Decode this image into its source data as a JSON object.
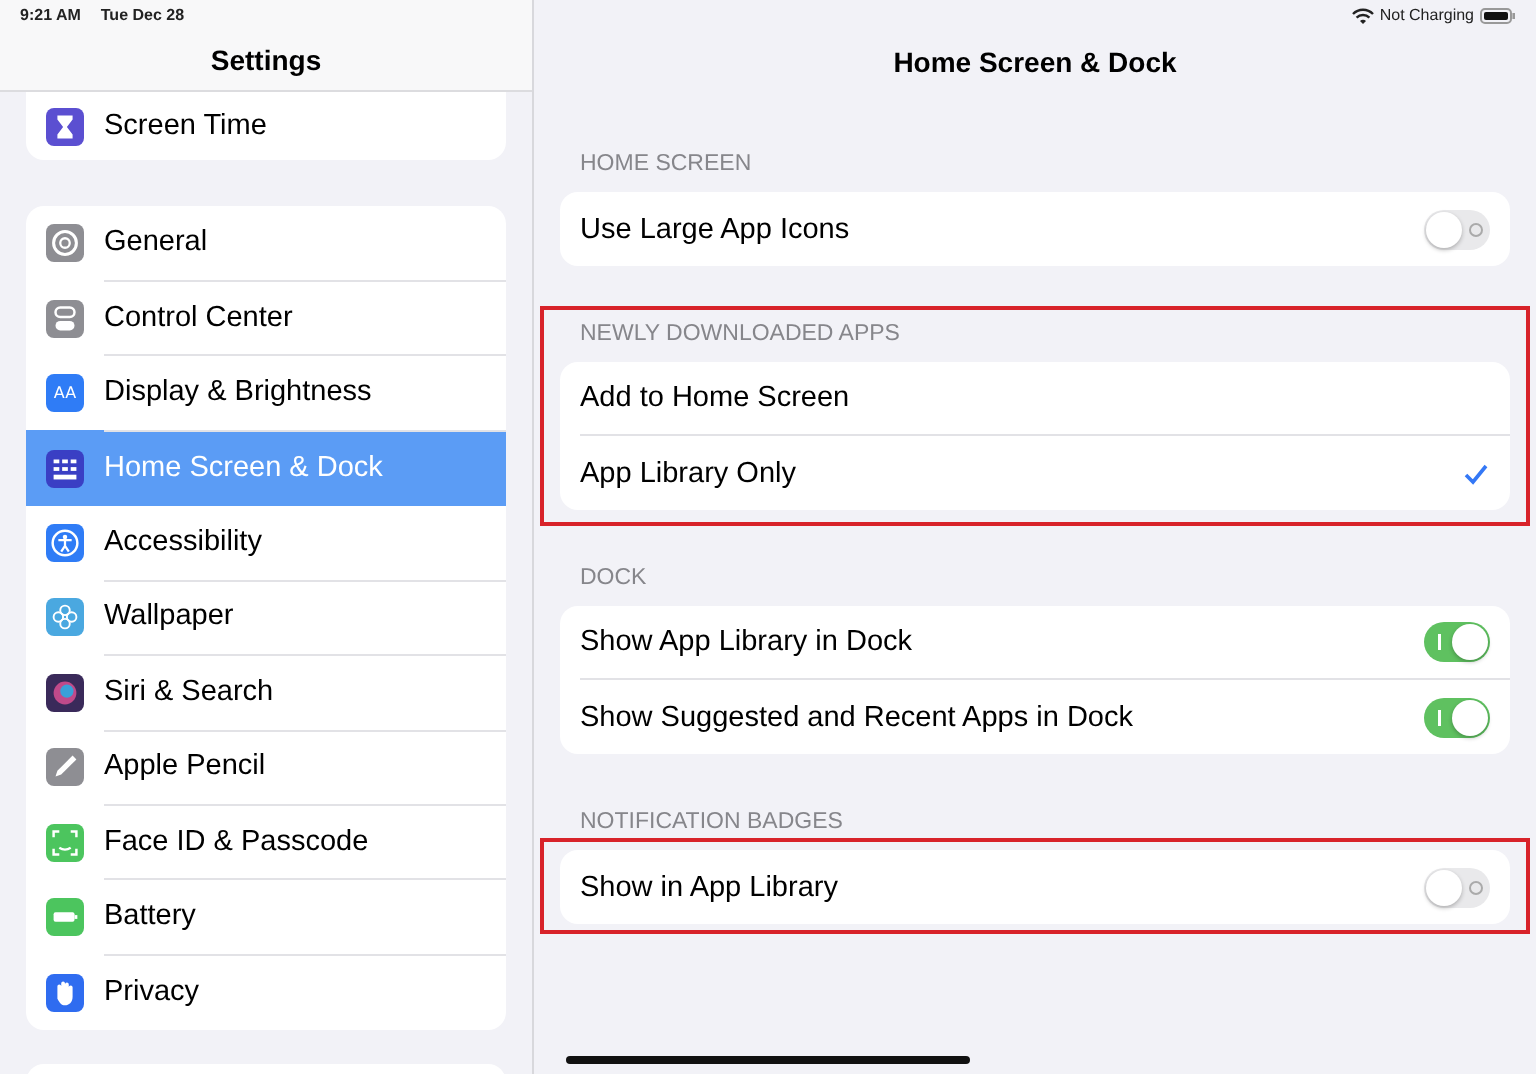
{
  "status_bar": {
    "time": "9:21 AM",
    "date": "Tue Dec 28",
    "charging": "Not Charging"
  },
  "sidebar": {
    "title": "Settings",
    "top_items": [
      {
        "label": "Screen Time",
        "kind": "hourglass",
        "color": "#5b4fd1",
        "selected": false
      }
    ],
    "items": [
      {
        "label": "General",
        "kind": "gear",
        "color": "#8e8e93",
        "selected": false
      },
      {
        "label": "Control Center",
        "kind": "switches",
        "color": "#8e8e93",
        "selected": false
      },
      {
        "label": "Display & Brightness",
        "kind": "text",
        "icon_text": "AA",
        "color": "#2f7cf6",
        "selected": false
      },
      {
        "label": "Home Screen & Dock",
        "kind": "grid",
        "color": "#3a3fc4",
        "selected": true
      },
      {
        "label": "Accessibility",
        "kind": "person",
        "color": "#2f7cf6",
        "selected": false
      },
      {
        "label": "Wallpaper",
        "kind": "flower",
        "color": "#4aa8e0",
        "selected": false
      },
      {
        "label": "Siri & Search",
        "kind": "orb",
        "color": "#3a2a5a",
        "selected": false
      },
      {
        "label": "Apple Pencil",
        "kind": "pencil",
        "color": "#8e8e93",
        "selected": false
      },
      {
        "label": "Face ID & Passcode",
        "kind": "face",
        "color": "#4cc55e",
        "selected": false
      },
      {
        "label": "Battery",
        "kind": "battery",
        "color": "#4cc55e",
        "selected": false
      },
      {
        "label": "Privacy",
        "kind": "hand",
        "color": "#2f6cf0",
        "selected": false
      }
    ]
  },
  "detail": {
    "title": "Home Screen & Dock",
    "sections": [
      {
        "header": "HOME SCREEN",
        "highlighted": false,
        "rows": [
          {
            "label": "Use Large App Icons",
            "kind": "toggle",
            "on": false
          }
        ]
      },
      {
        "header": "NEWLY DOWNLOADED APPS",
        "highlighted": true,
        "header_highlighted": true,
        "rows": [
          {
            "label": "Add to Home Screen",
            "kind": "option",
            "selected": false
          },
          {
            "label": "App Library Only",
            "kind": "option",
            "selected": true
          }
        ]
      },
      {
        "header": "DOCK",
        "highlighted": false,
        "rows": [
          {
            "label": "Show App Library in Dock",
            "kind": "toggle",
            "on": true
          },
          {
            "label": "Show Suggested and Recent Apps in Dock",
            "kind": "toggle",
            "on": true
          }
        ]
      },
      {
        "header": "NOTIFICATION BADGES",
        "highlighted": true,
        "header_highlighted": false,
        "rows": [
          {
            "label": "Show in App Library",
            "kind": "toggle",
            "on": false
          }
        ]
      }
    ]
  }
}
